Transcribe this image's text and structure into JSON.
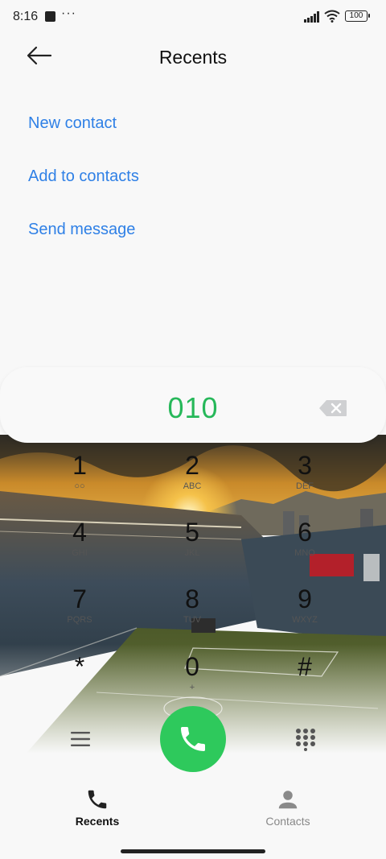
{
  "status_bar": {
    "time": "8:16",
    "overflow": "···",
    "battery": "100"
  },
  "header": {
    "title": "Recents"
  },
  "actions": [
    {
      "label": "New contact"
    },
    {
      "label": "Add to contacts"
    },
    {
      "label": "Send message"
    }
  ],
  "dialer": {
    "number": "010"
  },
  "keypad": [
    {
      "digit": "1",
      "letters": "○○"
    },
    {
      "digit": "2",
      "letters": "ABC"
    },
    {
      "digit": "3",
      "letters": "DEF"
    },
    {
      "digit": "4",
      "letters": "GHI"
    },
    {
      "digit": "5",
      "letters": "JKL"
    },
    {
      "digit": "6",
      "letters": "MNO"
    },
    {
      "digit": "7",
      "letters": "PQRS"
    },
    {
      "digit": "8",
      "letters": "TUV"
    },
    {
      "digit": "9",
      "letters": "WXYZ"
    },
    {
      "digit": "*",
      "letters": ""
    },
    {
      "digit": "0",
      "letters": "+"
    },
    {
      "digit": "#",
      "letters": ""
    }
  ],
  "tabs": [
    {
      "label": "Recents",
      "icon": "phone-icon"
    },
    {
      "label": "Contacts",
      "icon": "person-icon"
    }
  ],
  "colors": {
    "accent": "#2f80e6",
    "call": "#2ec95c",
    "number": "#27b85a"
  }
}
